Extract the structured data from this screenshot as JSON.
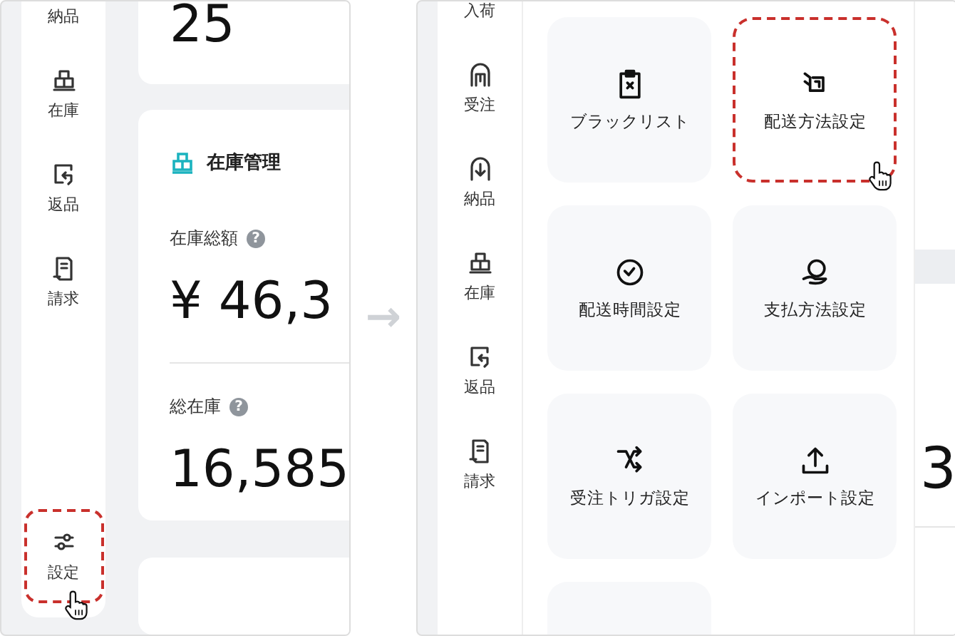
{
  "left_screen": {
    "sidebar": {
      "items": [
        {
          "label": "納品",
          "highlighted": false
        },
        {
          "label": "在庫",
          "highlighted": false
        },
        {
          "label": "返品",
          "highlighted": false
        },
        {
          "label": "請求",
          "highlighted": false
        },
        {
          "label": "設定",
          "highlighted": true
        }
      ]
    },
    "summary_card": {
      "value": "25"
    },
    "inventory_card": {
      "title": "在庫管理",
      "metrics": [
        {
          "label": "在庫総額",
          "help": "?",
          "value": "¥ 46,3"
        },
        {
          "label": "総在庫",
          "help": "?",
          "value": "16,585"
        }
      ]
    }
  },
  "arrow": "→",
  "right_screen": {
    "sidebar": {
      "items": [
        {
          "label": "入荷",
          "highlighted": false
        },
        {
          "label": "受注",
          "highlighted": false
        },
        {
          "label": "納品",
          "highlighted": false
        },
        {
          "label": "在庫",
          "highlighted": false
        },
        {
          "label": "返品",
          "highlighted": false
        },
        {
          "label": "請求",
          "highlighted": false
        }
      ]
    },
    "settings_tiles": [
      {
        "label": "ブラックリスト",
        "highlighted": false
      },
      {
        "label": "配送方法設定",
        "highlighted": true
      },
      {
        "label": "配送時間設定",
        "highlighted": false
      },
      {
        "label": "支払方法設定",
        "highlighted": false
      },
      {
        "label": "受注トリガ設定",
        "highlighted": false
      },
      {
        "label": "インポート設定",
        "highlighted": false
      }
    ],
    "background_value": "3"
  }
}
